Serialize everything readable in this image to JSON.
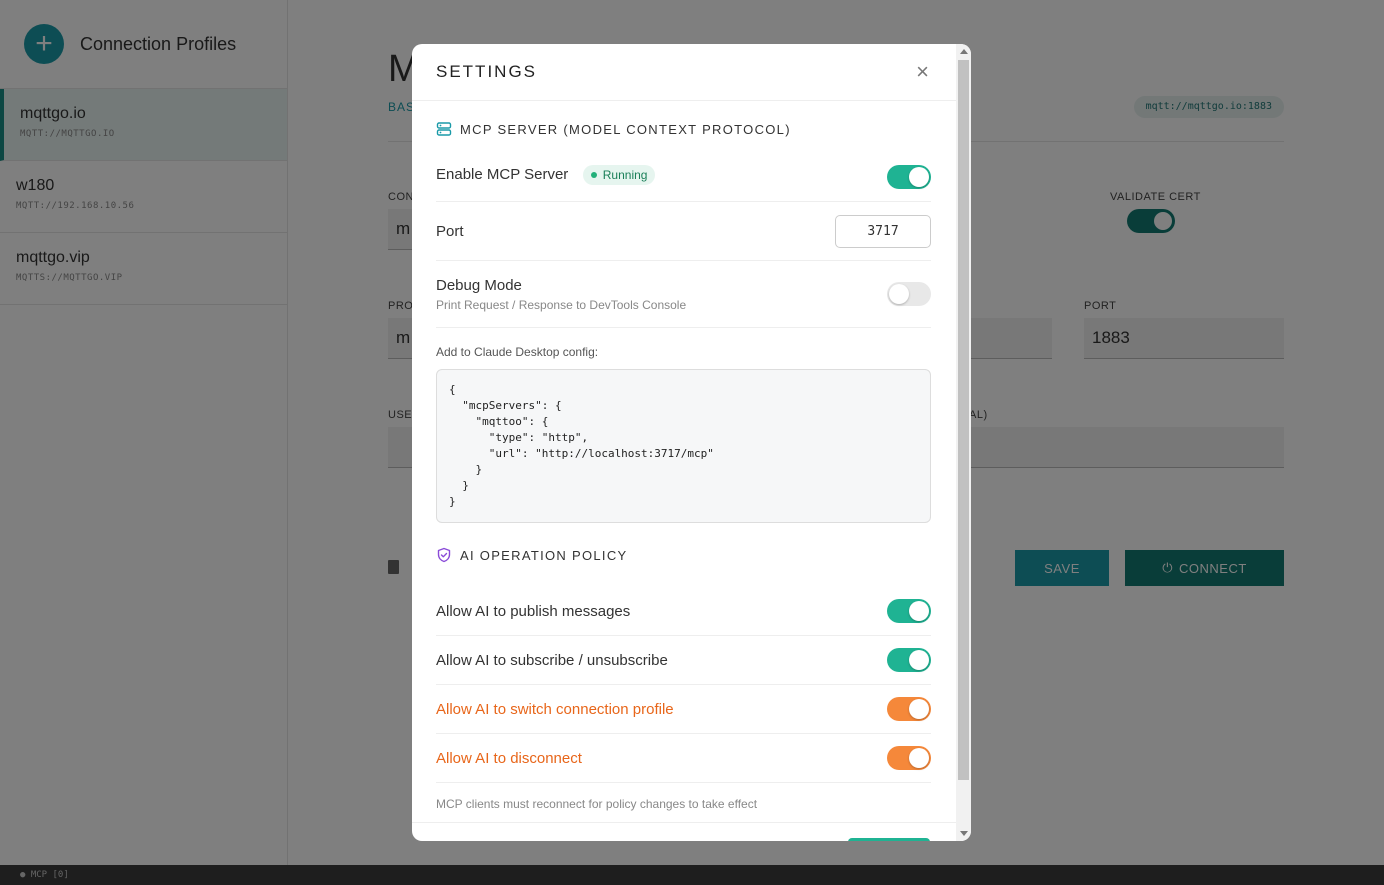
{
  "sidebar": {
    "title": "Connection Profiles",
    "add_icon": "+",
    "profiles": [
      {
        "name": "mqttgo.io",
        "url": "MQTT://MQTTGO.IO"
      },
      {
        "name": "w180",
        "url": "MQTT://192.168.10.56"
      },
      {
        "name": "mqttgo.vip",
        "url": "MQTTS://MQTTGO.VIP"
      }
    ]
  },
  "main": {
    "title": "M",
    "subtitle": "BAS",
    "url_pill": "mqtt://mqttgo.io:1883",
    "labels": {
      "con": "CON",
      "validate_cert": "VALIDATE CERT",
      "prot": "PROT",
      "port": "PORT",
      "user": "USER",
      "al": "AL)"
    },
    "values": {
      "con_value": "m",
      "prot_value": "m",
      "port_value": "1883"
    },
    "save_label": "SAVE",
    "connect_label": "CONNECT",
    "trash_partial": "I"
  },
  "statusbar": {
    "text": "● MCP [0]"
  },
  "modal": {
    "title": "SETTINGS",
    "close_icon": "×",
    "mcp_section_title": "MCP SERVER (MODEL CONTEXT PROTOCOL)",
    "enable_label": "Enable MCP Server",
    "status_badge": "Running",
    "port_label": "Port",
    "port_value": "3717",
    "debug_label": "Debug Mode",
    "debug_sublabel": "Print Request / Response to DevTools Console",
    "config_label": "Add to Claude Desktop config:",
    "config_code": "{\n  \"mcpServers\": {\n    \"mqttoo\": {\n      \"type\": \"http\",\n      \"url\": \"http://localhost:3717/mcp\"\n    }\n  }\n}",
    "policy_section_title": "AI OPERATION POLICY",
    "policies": [
      {
        "label": "Allow AI to publish messages",
        "enabled": true,
        "color": "#1fb393"
      },
      {
        "label": "Allow AI to subscribe / unsubscribe",
        "enabled": true,
        "color": "#1fb393"
      },
      {
        "label": "Allow AI to switch connection profile",
        "enabled": true,
        "color": "#f5883a"
      },
      {
        "label": "Allow AI to disconnect",
        "enabled": true,
        "color": "#f5883a"
      }
    ],
    "footnote": "MCP clients must reconnect for policy changes to take effect"
  },
  "colors": {
    "accent_teal": "#1a9aa8",
    "accent_dark_teal": "#127a72",
    "toggle_green": "#1fb393",
    "toggle_orange": "#f5883a",
    "warn_text": "#e8661a"
  }
}
